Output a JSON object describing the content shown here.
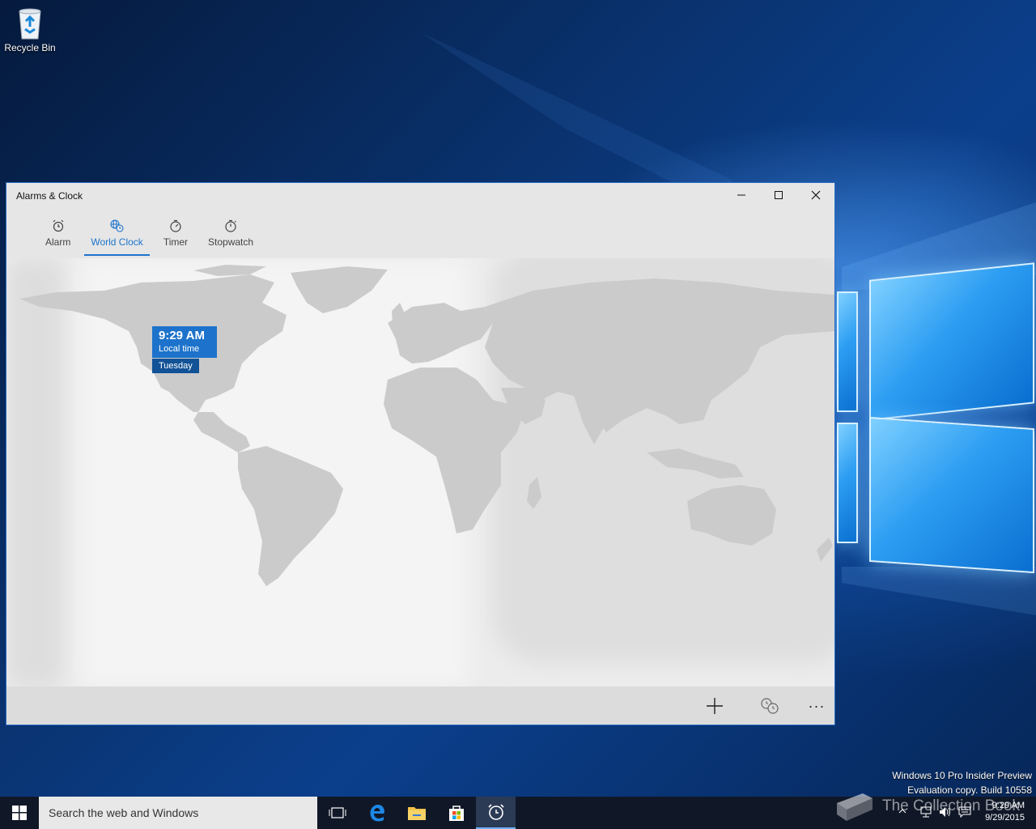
{
  "desktop": {
    "recycle_bin_label": "Recycle Bin",
    "build_info_line1": "Windows 10 Pro Insider Preview",
    "build_info_line2": "Evaluation copy. Build 10558",
    "watermark_text": "The Collection Book"
  },
  "window": {
    "title": "Alarms & Clock",
    "tabs": [
      {
        "label": "Alarm",
        "icon": "alarm-clock-icon"
      },
      {
        "label": "World Clock",
        "icon": "globe-clock-icon",
        "active": true
      },
      {
        "label": "Timer",
        "icon": "timer-icon"
      },
      {
        "label": "Stopwatch",
        "icon": "stopwatch-icon"
      }
    ],
    "local_time": {
      "time": "9:29 AM",
      "label": "Local time",
      "day": "Tuesday"
    },
    "appbar": {
      "add_icon": "plus-icon",
      "compare_icon": "compare-clock-icon",
      "more_label": "···"
    }
  },
  "taskbar": {
    "search_placeholder": "Search the web and Windows",
    "time": "9:29 AM",
    "date": "9/29/2015"
  },
  "colors": {
    "accent": "#1d73cb",
    "accent_dark": "#125296",
    "map_land": "#c9c9c9",
    "map_bg": "#ececec"
  }
}
